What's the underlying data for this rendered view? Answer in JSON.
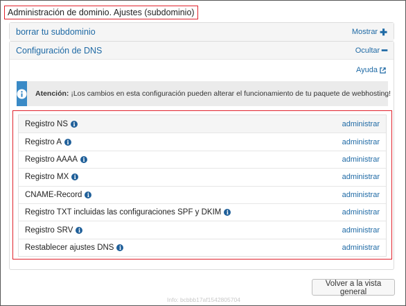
{
  "page": {
    "title": "Administración de dominio. Ajustes (subdominio)"
  },
  "panel_delete": {
    "title": "borrar tu subdominio",
    "toggle_label": "Mostrar",
    "toggle_icon": "plus-icon"
  },
  "panel_dns": {
    "title": "Configuración de DNS",
    "toggle_label": "Ocultar",
    "toggle_icon": "minus-icon"
  },
  "help": {
    "label": "Ayuda",
    "icon": "external-link-icon"
  },
  "alert": {
    "icon": "info-icon",
    "strong": "Atención:",
    "message": "¡Los cambios en esta configuración pueden alterar el funcionamiento de tu paquete de webhosting!"
  },
  "dns_records": [
    {
      "label": "Registro NS",
      "action": "administrar"
    },
    {
      "label": "Registro A",
      "action": "administrar"
    },
    {
      "label": "Registro AAAA",
      "action": "administrar"
    },
    {
      "label": "Registro MX",
      "action": "administrar"
    },
    {
      "label": "CNAME-Record",
      "action": "administrar"
    },
    {
      "label": "Registro TXT incluidas las configuraciones SPF y DKIM",
      "action": "administrar"
    },
    {
      "label": "Registro SRV",
      "action": "administrar"
    },
    {
      "label": "Restablecer ajustes DNS",
      "action": "administrar"
    }
  ],
  "back_button": {
    "label": "Volver a la vista general"
  },
  "footer": {
    "info": "Info: bcbbb17af1542805704"
  },
  "colors": {
    "accent": "#1f6aa5",
    "highlight": "#e0212b",
    "alert_icon_bg": "#3a8ac6"
  }
}
